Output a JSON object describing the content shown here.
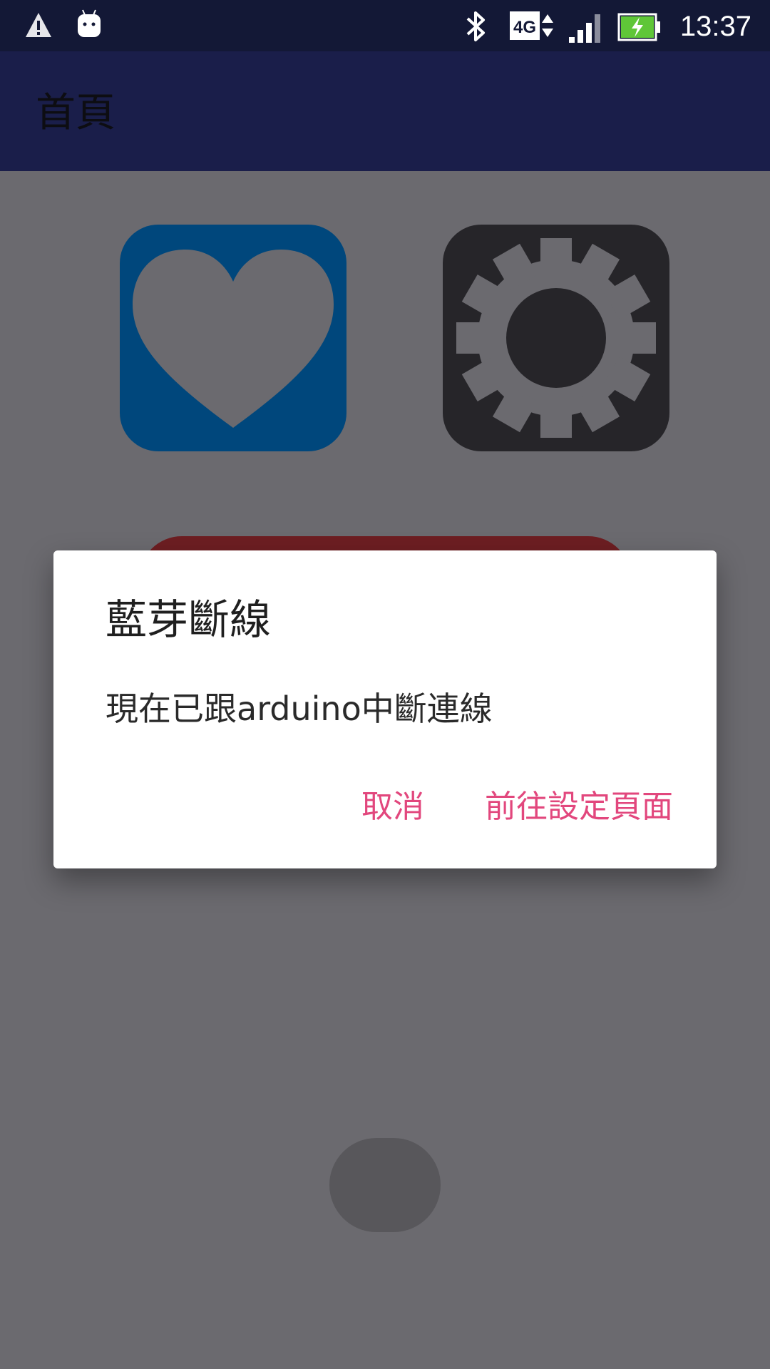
{
  "status_bar": {
    "time": "13:37",
    "network": "4G",
    "icons": [
      "warning-icon",
      "android-icon",
      "bluetooth-icon",
      "network-4g-icon",
      "signal-icon",
      "battery-charging-icon"
    ]
  },
  "app_bar": {
    "title": "首頁"
  },
  "tiles": [
    {
      "name": "heart",
      "icon": "heart-icon",
      "color": "#00477c"
    },
    {
      "name": "settings",
      "icon": "gear-icon",
      "color": "#262529"
    }
  ],
  "dialog": {
    "title": "藍芽斷線",
    "message": "現在已跟arduino中斷連線",
    "cancel_label": "取消",
    "confirm_label": "前往設定頁面",
    "accent_color": "#e2477d"
  }
}
